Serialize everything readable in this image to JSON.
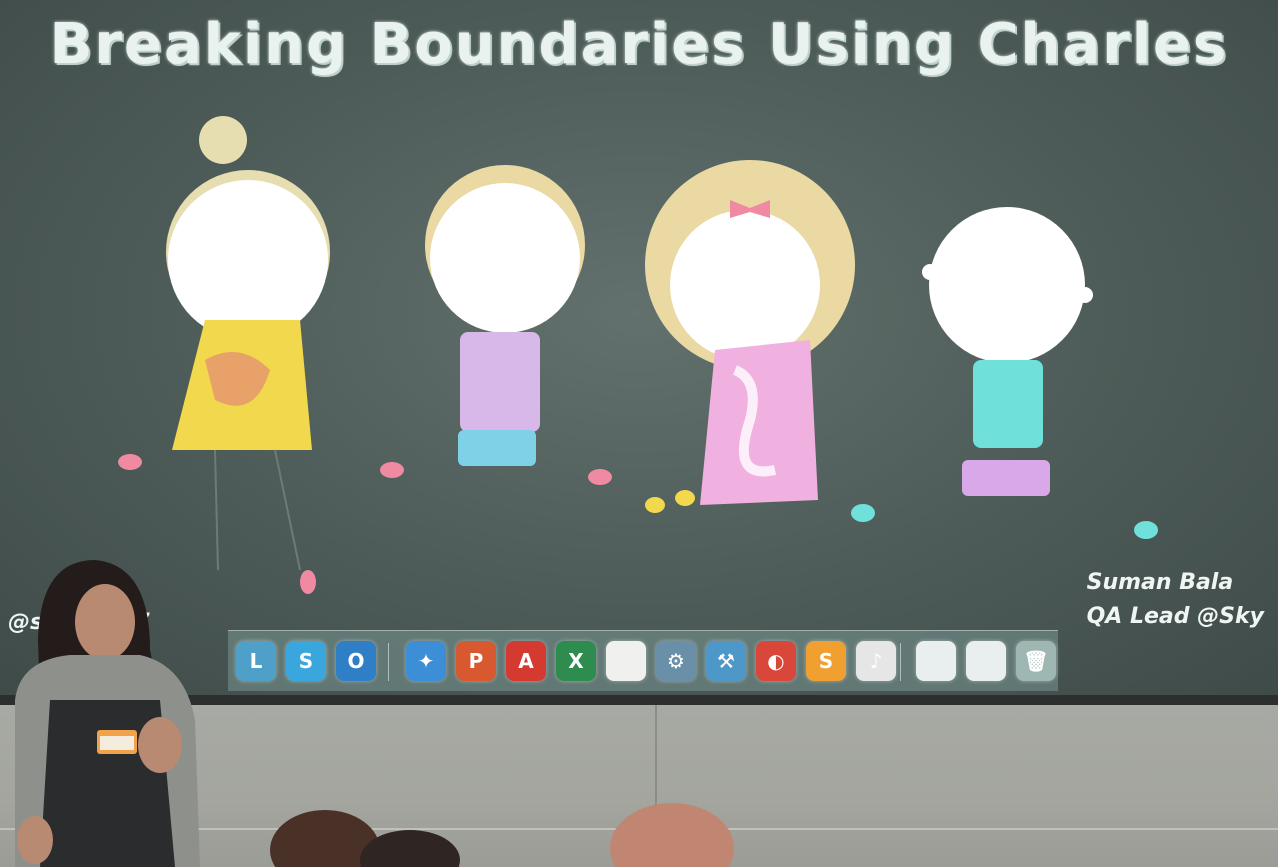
{
  "slide": {
    "title": "Breaking Boundaries Using Charles",
    "presenter_name": "Suman Bala",
    "presenter_role": "QA Lead @Sky",
    "twitter_handle": "@s           bala867"
  },
  "dock": {
    "icons": [
      {
        "name": "finder-icon",
        "glyph": "L",
        "color": "#4fa0c9"
      },
      {
        "name": "skype-icon",
        "glyph": "S",
        "color": "#3aa6de"
      },
      {
        "name": "outlook-icon",
        "glyph": "O",
        "color": "#2f7fc7"
      },
      {
        "name": "safari-icon",
        "glyph": "✦",
        "color": "#3c8fd6"
      },
      {
        "name": "powerpoint-icon",
        "glyph": "P",
        "color": "#d8592f"
      },
      {
        "name": "acrobat-icon",
        "glyph": "A",
        "color": "#d43a2f"
      },
      {
        "name": "excel-icon",
        "glyph": "X",
        "color": "#2d8c4e"
      },
      {
        "name": "notes-icon",
        "glyph": "",
        "color": "#f0f0ee"
      },
      {
        "name": "system-prefs-icon",
        "glyph": "⚙",
        "color": "#6a8fa8"
      },
      {
        "name": "xcode-icon",
        "glyph": "⚒",
        "color": "#4d97c9"
      },
      {
        "name": "charles-icon",
        "glyph": "◐",
        "color": "#d9463a"
      },
      {
        "name": "sublime-icon",
        "glyph": "S",
        "color": "#f0a030"
      },
      {
        "name": "itunes-icon",
        "glyph": "♪",
        "color": "#e6e6e6"
      },
      {
        "name": "preview-icon",
        "glyph": "",
        "color": "#e9efee"
      },
      {
        "name": "preview-icon-2",
        "glyph": "",
        "color": "#e9efee"
      },
      {
        "name": "trash-icon",
        "glyph": "🗑",
        "color": "#9fb7b2"
      }
    ]
  }
}
